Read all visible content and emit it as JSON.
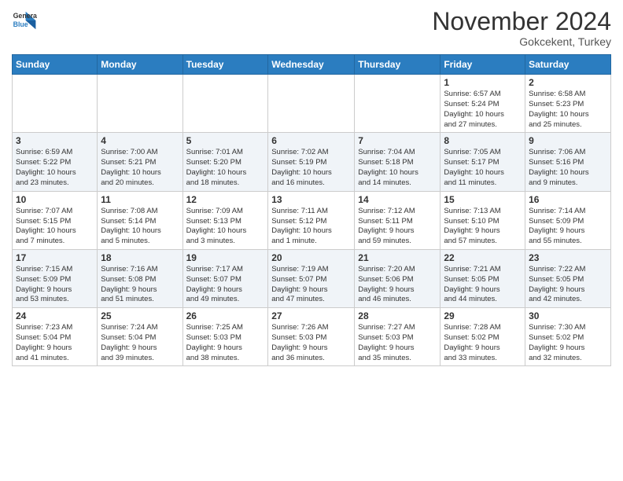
{
  "header": {
    "logo_line1": "General",
    "logo_line2": "Blue",
    "month": "November 2024",
    "location": "Gokcekent, Turkey"
  },
  "weekdays": [
    "Sunday",
    "Monday",
    "Tuesday",
    "Wednesday",
    "Thursday",
    "Friday",
    "Saturday"
  ],
  "weeks": [
    [
      {
        "day": "",
        "info": ""
      },
      {
        "day": "",
        "info": ""
      },
      {
        "day": "",
        "info": ""
      },
      {
        "day": "",
        "info": ""
      },
      {
        "day": "",
        "info": ""
      },
      {
        "day": "1",
        "info": "Sunrise: 6:57 AM\nSunset: 5:24 PM\nDaylight: 10 hours\nand 27 minutes."
      },
      {
        "day": "2",
        "info": "Sunrise: 6:58 AM\nSunset: 5:23 PM\nDaylight: 10 hours\nand 25 minutes."
      }
    ],
    [
      {
        "day": "3",
        "info": "Sunrise: 6:59 AM\nSunset: 5:22 PM\nDaylight: 10 hours\nand 23 minutes."
      },
      {
        "day": "4",
        "info": "Sunrise: 7:00 AM\nSunset: 5:21 PM\nDaylight: 10 hours\nand 20 minutes."
      },
      {
        "day": "5",
        "info": "Sunrise: 7:01 AM\nSunset: 5:20 PM\nDaylight: 10 hours\nand 18 minutes."
      },
      {
        "day": "6",
        "info": "Sunrise: 7:02 AM\nSunset: 5:19 PM\nDaylight: 10 hours\nand 16 minutes."
      },
      {
        "day": "7",
        "info": "Sunrise: 7:04 AM\nSunset: 5:18 PM\nDaylight: 10 hours\nand 14 minutes."
      },
      {
        "day": "8",
        "info": "Sunrise: 7:05 AM\nSunset: 5:17 PM\nDaylight: 10 hours\nand 11 minutes."
      },
      {
        "day": "9",
        "info": "Sunrise: 7:06 AM\nSunset: 5:16 PM\nDaylight: 10 hours\nand 9 minutes."
      }
    ],
    [
      {
        "day": "10",
        "info": "Sunrise: 7:07 AM\nSunset: 5:15 PM\nDaylight: 10 hours\nand 7 minutes."
      },
      {
        "day": "11",
        "info": "Sunrise: 7:08 AM\nSunset: 5:14 PM\nDaylight: 10 hours\nand 5 minutes."
      },
      {
        "day": "12",
        "info": "Sunrise: 7:09 AM\nSunset: 5:13 PM\nDaylight: 10 hours\nand 3 minutes."
      },
      {
        "day": "13",
        "info": "Sunrise: 7:11 AM\nSunset: 5:12 PM\nDaylight: 10 hours\nand 1 minute."
      },
      {
        "day": "14",
        "info": "Sunrise: 7:12 AM\nSunset: 5:11 PM\nDaylight: 9 hours\nand 59 minutes."
      },
      {
        "day": "15",
        "info": "Sunrise: 7:13 AM\nSunset: 5:10 PM\nDaylight: 9 hours\nand 57 minutes."
      },
      {
        "day": "16",
        "info": "Sunrise: 7:14 AM\nSunset: 5:09 PM\nDaylight: 9 hours\nand 55 minutes."
      }
    ],
    [
      {
        "day": "17",
        "info": "Sunrise: 7:15 AM\nSunset: 5:09 PM\nDaylight: 9 hours\nand 53 minutes."
      },
      {
        "day": "18",
        "info": "Sunrise: 7:16 AM\nSunset: 5:08 PM\nDaylight: 9 hours\nand 51 minutes."
      },
      {
        "day": "19",
        "info": "Sunrise: 7:17 AM\nSunset: 5:07 PM\nDaylight: 9 hours\nand 49 minutes."
      },
      {
        "day": "20",
        "info": "Sunrise: 7:19 AM\nSunset: 5:07 PM\nDaylight: 9 hours\nand 47 minutes."
      },
      {
        "day": "21",
        "info": "Sunrise: 7:20 AM\nSunset: 5:06 PM\nDaylight: 9 hours\nand 46 minutes."
      },
      {
        "day": "22",
        "info": "Sunrise: 7:21 AM\nSunset: 5:05 PM\nDaylight: 9 hours\nand 44 minutes."
      },
      {
        "day": "23",
        "info": "Sunrise: 7:22 AM\nSunset: 5:05 PM\nDaylight: 9 hours\nand 42 minutes."
      }
    ],
    [
      {
        "day": "24",
        "info": "Sunrise: 7:23 AM\nSunset: 5:04 PM\nDaylight: 9 hours\nand 41 minutes."
      },
      {
        "day": "25",
        "info": "Sunrise: 7:24 AM\nSunset: 5:04 PM\nDaylight: 9 hours\nand 39 minutes."
      },
      {
        "day": "26",
        "info": "Sunrise: 7:25 AM\nSunset: 5:03 PM\nDaylight: 9 hours\nand 38 minutes."
      },
      {
        "day": "27",
        "info": "Sunrise: 7:26 AM\nSunset: 5:03 PM\nDaylight: 9 hours\nand 36 minutes."
      },
      {
        "day": "28",
        "info": "Sunrise: 7:27 AM\nSunset: 5:03 PM\nDaylight: 9 hours\nand 35 minutes."
      },
      {
        "day": "29",
        "info": "Sunrise: 7:28 AM\nSunset: 5:02 PM\nDaylight: 9 hours\nand 33 minutes."
      },
      {
        "day": "30",
        "info": "Sunrise: 7:30 AM\nSunset: 5:02 PM\nDaylight: 9 hours\nand 32 minutes."
      }
    ]
  ]
}
